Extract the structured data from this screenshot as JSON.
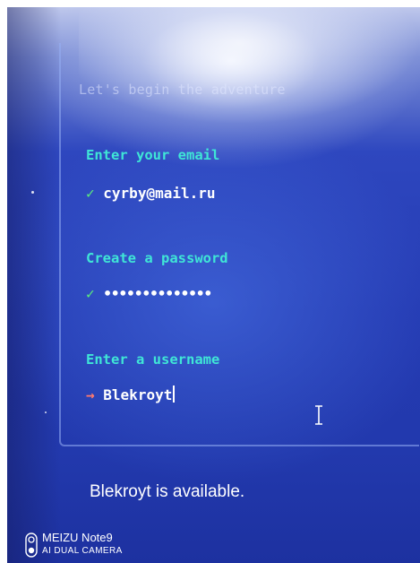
{
  "terminal": {
    "subtitle": "Let's begin the adventure",
    "email": {
      "label": "Enter your email",
      "prompt": "✓",
      "value": "cyrby@mail.ru"
    },
    "password": {
      "label": "Create a password",
      "prompt": "✓",
      "value": "••••••••••••••"
    },
    "username": {
      "label": "Enter a username",
      "prompt": "→",
      "value": "Blekroyt"
    }
  },
  "status": {
    "message": "Blekroyt is available."
  },
  "watermark": {
    "brand": "MEIZU Note9",
    "camera": "AI DUAL CAMERA"
  },
  "colors": {
    "label": "#3fe6d6",
    "check": "#5cf07a",
    "arrow": "#ff7a6e",
    "text": "#ffffff",
    "background": "#2439b0"
  },
  "icons": {
    "cursor": "text-cursor-ibeam-icon",
    "camera": "camera-lens-icon"
  }
}
